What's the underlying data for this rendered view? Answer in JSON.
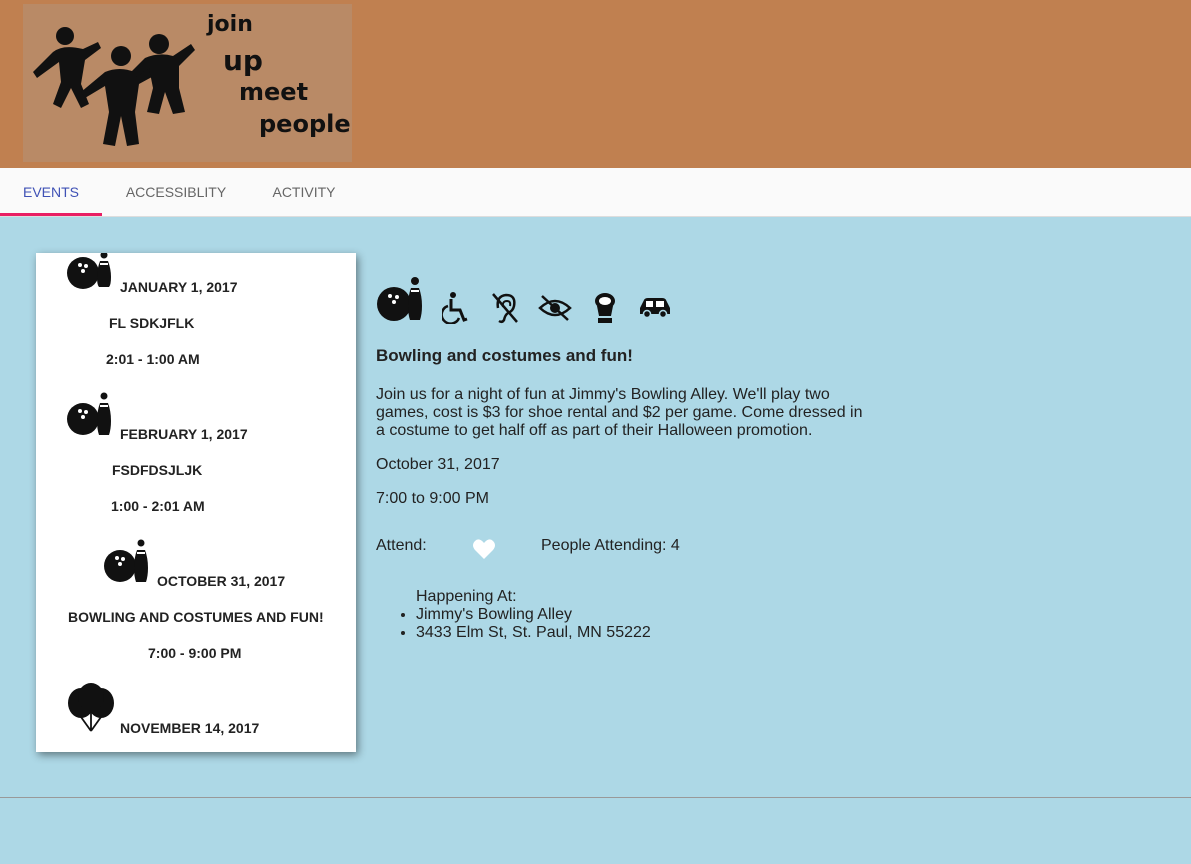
{
  "logo": {
    "words": [
      "join",
      "up",
      "meet",
      "people"
    ]
  },
  "tabs": [
    {
      "label": "EVENTS",
      "active": true
    },
    {
      "label": "ACCESSIBLITY",
      "active": false
    },
    {
      "label": "ACTIVITY",
      "active": false
    }
  ],
  "sidebar": {
    "events": [
      {
        "icon": "bowling-icon",
        "date": "JANUARY 1, 2017",
        "name": "FL SDKJFLK",
        "time": "2:01 - 1:00 AM"
      },
      {
        "icon": "bowling-icon",
        "date": "FEBRUARY 1, 2017",
        "name": "FSDFDSJLJK",
        "time": "1:00 - 2:01 AM"
      },
      {
        "icon": "bowling-icon",
        "date": "OCTOBER 31, 2017",
        "name": "BOWLING AND COSTUMES AND FUN!",
        "time": "7:00 - 9:00 PM"
      },
      {
        "icon": "balloons-icon",
        "date": "NOVEMBER 14, 2017"
      }
    ]
  },
  "detail": {
    "accessibility_icons": [
      "bowling-icon",
      "wheelchair-icon",
      "hearing-impaired-icon",
      "vision-impaired-icon",
      "restroom-icon",
      "car-icon"
    ],
    "title": "Bowling and costumes and fun!",
    "description": "Join us for a night of fun at Jimmy's Bowling Alley. We'll play two games, cost is $3 for shoe rental and $2 per game. Come dressed in a costume to get half off as part of their Halloween promotion.",
    "date": "October 31, 2017",
    "time": "7:00 to 9:00 PM",
    "attend_label": "Attend:",
    "people_attending": "People Attending: 4",
    "happening_label": "Happening At:",
    "address": [
      "Jimmy's Bowling Alley",
      "3433 Elm St, St. Paul, MN 55222"
    ]
  },
  "colors": {
    "header": "#c08050",
    "background": "#add8e6",
    "active_tab": "#3f51b5",
    "tab_indicator": "#e91e63"
  }
}
